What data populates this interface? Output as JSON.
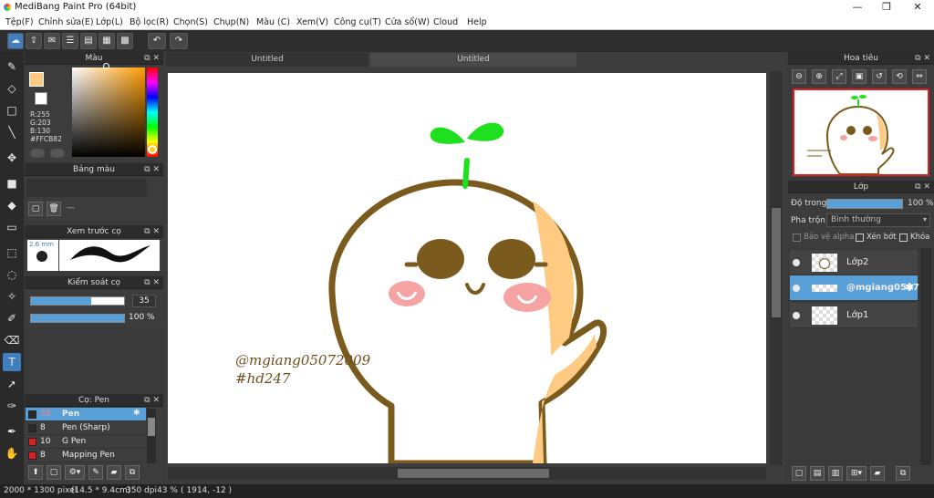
{
  "window": {
    "title": "MediBang Paint Pro (64bit)",
    "minimize": "—",
    "maximize": "❐",
    "close": "✕"
  },
  "menu": [
    "Tệp(F)",
    "Chỉnh sửa(E)",
    "Lớp(L)",
    "Bộ lọc(R)",
    "Chọn(S)",
    "Chụp(N)",
    "Màu (C)",
    "Xem(V)",
    "Công cụ(T)",
    "Cửa sổ(W)",
    "Cloud",
    "Help"
  ],
  "tabs": [
    "Untitled",
    "Untitled"
  ],
  "color_panel": {
    "title": "Màu",
    "r": "R:255",
    "g": "G:203",
    "b": "B:130",
    "hex": "#FFCB82",
    "fg_color": "#ffcb82"
  },
  "palette_panel": {
    "title": "Bảng màu",
    "placeholder": "---"
  },
  "brush_preview": {
    "title": "Xem trước cọ",
    "size": "2.6 mm"
  },
  "brush_control": {
    "title": "Kiểm soát cọ",
    "size": "35",
    "opacity": "100 %",
    "size_level": 0.65,
    "opacity_level": 1.0
  },
  "brush_panel": {
    "title": "Cọ: Pen",
    "items": [
      {
        "size": "35",
        "name": "Pen",
        "color": "#2a2a2a",
        "selected": true
      },
      {
        "size": "8",
        "name": "Pen (Sharp)",
        "color": "#2a2a2a",
        "selected": false
      },
      {
        "size": "10",
        "name": "G Pen",
        "color": "#e02020",
        "selected": false
      },
      {
        "size": "8",
        "name": "Mapping Pen",
        "color": "#e02020",
        "selected": false
      }
    ]
  },
  "navigator": {
    "title": "Hoa tiêu"
  },
  "layer_panel": {
    "title": "Lớp",
    "opacity_label": "Độ trong",
    "opacity_value": "100 %",
    "blend_label": "Pha trộn",
    "blend_value": "Bình thường",
    "protect_alpha": "Bảo vệ alpha",
    "clipping": "Xén bớt",
    "lock": "Khóa",
    "layers": [
      {
        "name": "Lớp2",
        "selected": false
      },
      {
        "name": "@mgiang0507",
        "selected": true
      },
      {
        "name": "Lớp1",
        "selected": false
      }
    ]
  },
  "canvas": {
    "watermark_line1": "@mgiang05072009",
    "watermark_line2": "#hd247"
  },
  "status": {
    "size": "2000 * 1300 pixel",
    "physical": "(14.5 * 9.4cm)",
    "dpi": "350 dpi",
    "zoom": "43 %",
    "coords": "( 1914, -12 )"
  },
  "colors": {
    "accent": "#5aa0d8",
    "bean": "#7b5a1e",
    "sprout": "#1ee01e",
    "blush": "#f5a3a3",
    "shade": "#ffcb82"
  }
}
